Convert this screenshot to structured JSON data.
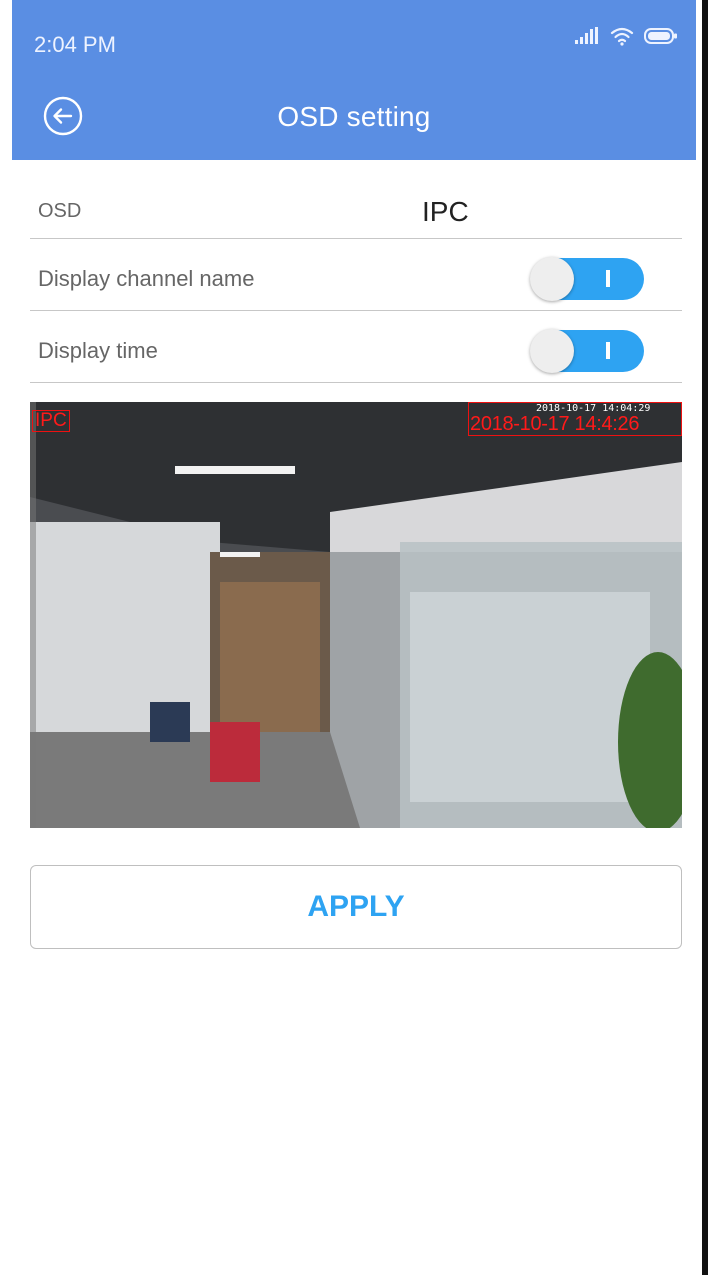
{
  "status_bar": {
    "time": "2:04 PM"
  },
  "header": {
    "title": "OSD setting",
    "back_icon": "back-arrow-icon"
  },
  "osd_row": {
    "label": "OSD",
    "value": "IPC"
  },
  "toggles": [
    {
      "label": "Display channel name",
      "on": true
    },
    {
      "label": "Display time",
      "on": true
    }
  ],
  "preview": {
    "channel_overlay": "IPC",
    "time_overlay": "2018-10-17 14:4:26",
    "time_overlay_small": "2018-10-17 14:04:29"
  },
  "apply_button": {
    "label": "APPLY"
  },
  "colors": {
    "appbar": "#5a8ee3",
    "accent": "#2ea3f2",
    "overlay": "#ff1a1a"
  }
}
